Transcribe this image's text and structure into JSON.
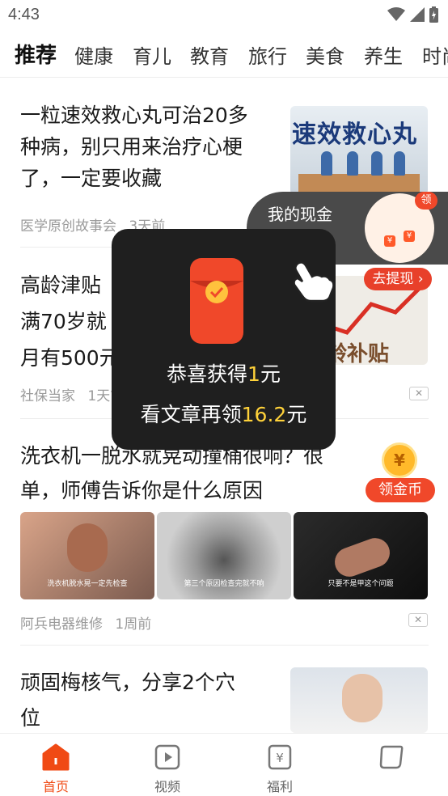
{
  "status": {
    "time": "4:43"
  },
  "tabs": [
    "推荐",
    "健康",
    "育儿",
    "教育",
    "旅行",
    "美食",
    "养生",
    "时尚"
  ],
  "articles": [
    {
      "title_lines": [
        "一粒速效救心丸可治20多",
        "种病，别只用来治疗心梗",
        "了，一定要收藏"
      ],
      "source": "医学原创故事会",
      "time": "3天前",
      "thumb_text": "速效救心丸"
    },
    {
      "title_lines": [
        "高龄津贴",
        "满70岁就",
        "月有500元"
      ],
      "source": "社保当家",
      "time": "1天前",
      "thumb_text": "龄补贴"
    },
    {
      "title_lines": [
        "洗衣机一脱水就晃动撞桶很响？很",
        "单，师傅告诉你是什么原因"
      ],
      "source": "阿兵电器维修",
      "time": "1周前",
      "captions": [
        "洗衣机脱水晃一定先检查",
        "第三个原因检查完就不响",
        "只要不是甲这个问题"
      ]
    },
    {
      "title_lines": [
        "顽固梅核气，分享2个穴",
        "位"
      ]
    }
  ],
  "popup": {
    "line1_pre": "恭喜获得",
    "line1_amount": "1",
    "line1_post": "元",
    "line2_pre": "看文章再领",
    "line2_amount": "16.2",
    "line2_post": "元"
  },
  "cash_widget": {
    "label": "我的现金",
    "badge": "领",
    "coin": "¥"
  },
  "withdraw_button": "去提现",
  "coin_button": "领金币",
  "coin_symbol": "¥",
  "bottom_nav": [
    {
      "label": "首页",
      "icon": "home-icon"
    },
    {
      "label": "视频",
      "icon": "video-icon"
    },
    {
      "label": "福利",
      "icon": "welfare-icon"
    },
    {
      "label": "",
      "icon": "profile-icon"
    }
  ],
  "colors": {
    "accent": "#f04a14",
    "gold": "#ffd23a",
    "popup_bg": "#1f1f1f"
  }
}
